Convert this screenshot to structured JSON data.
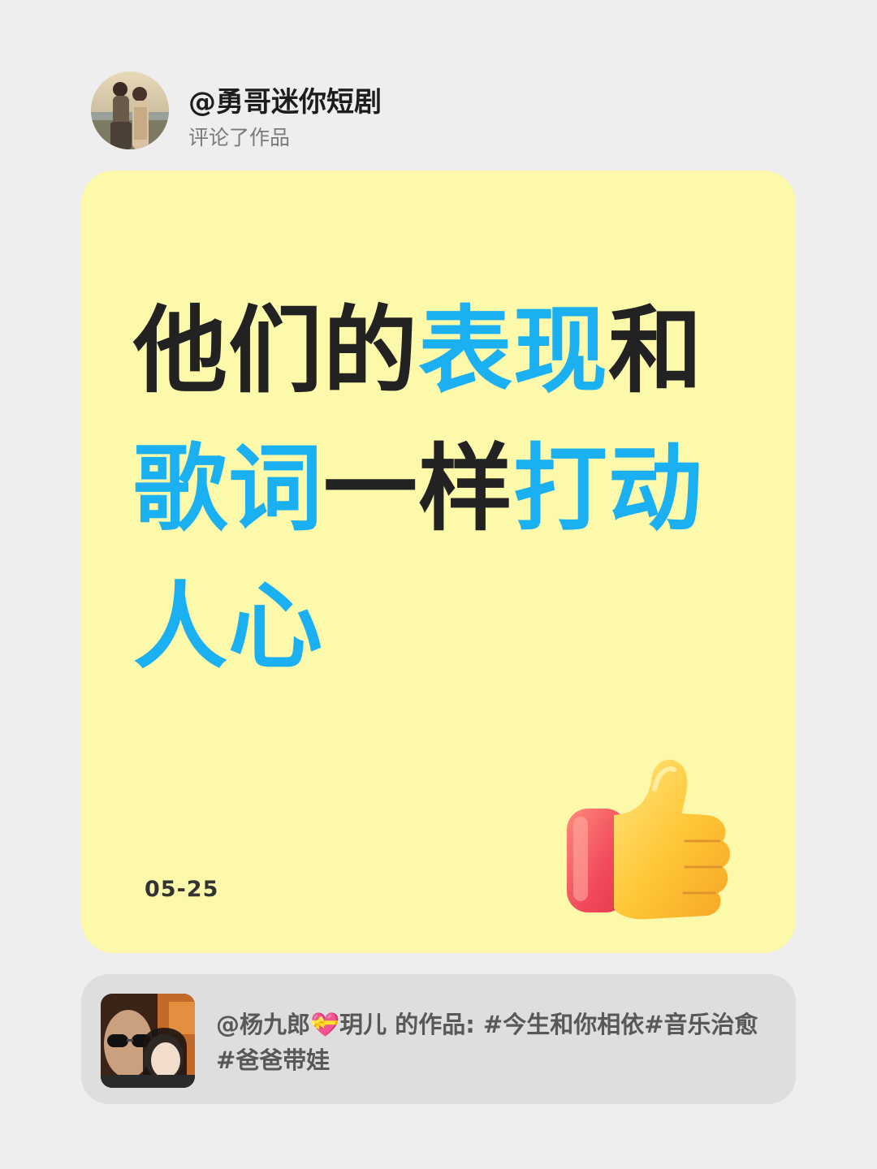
{
  "header": {
    "username": "@勇哥迷你短剧",
    "action": "评论了作品"
  },
  "comment": {
    "headline": [
      [
        {
          "text": "他们的",
          "accent": false
        },
        {
          "text": "表现",
          "accent": true
        },
        {
          "text": "和",
          "accent": false
        }
      ],
      [
        {
          "text": "歌词",
          "accent": true
        },
        {
          "text": "一样",
          "accent": false
        },
        {
          "text": "打动",
          "accent": true
        }
      ],
      [
        {
          "text": "人心",
          "accent": true
        }
      ]
    ],
    "date": "05-25",
    "emoji": "thumbs-up-icon"
  },
  "source": {
    "text": "@杨九郎💝玥儿 的作品: #今生和你相依#音乐治愈 #爸爸带娃"
  },
  "colors": {
    "background": "#eeeeee",
    "card": "#fdf9ab",
    "accent": "#1ab0f2",
    "dark_text": "#222222",
    "source_card": "#dedede"
  }
}
